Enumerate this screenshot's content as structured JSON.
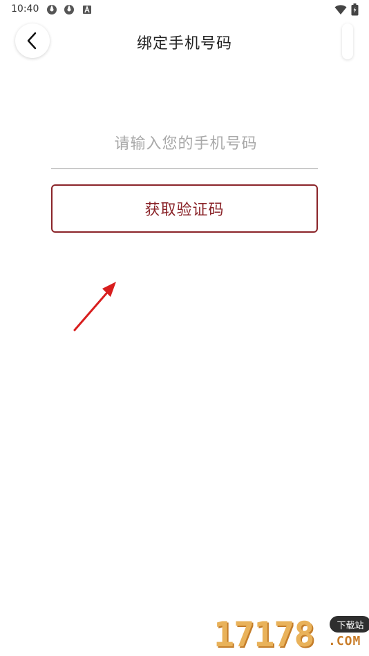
{
  "status_bar": {
    "time": "10:40",
    "icons": [
      "app-notification-icon",
      "app-notification-icon",
      "font-app-icon",
      "wifi-icon",
      "battery-icon"
    ]
  },
  "header": {
    "title": "绑定手机号码",
    "back_icon": "chevron-left-icon"
  },
  "form": {
    "phone_placeholder": "请输入您的手机号码",
    "phone_value": "",
    "get_code_label": "获取验证码"
  },
  "watermark": {
    "number": "17178",
    "badge": "下载站",
    "domain": ".COM"
  },
  "colors": {
    "accent": "#8a2328",
    "placeholder": "#a8a8a8",
    "divider": "#9a9a9a",
    "arrow": "#d81e1e"
  }
}
